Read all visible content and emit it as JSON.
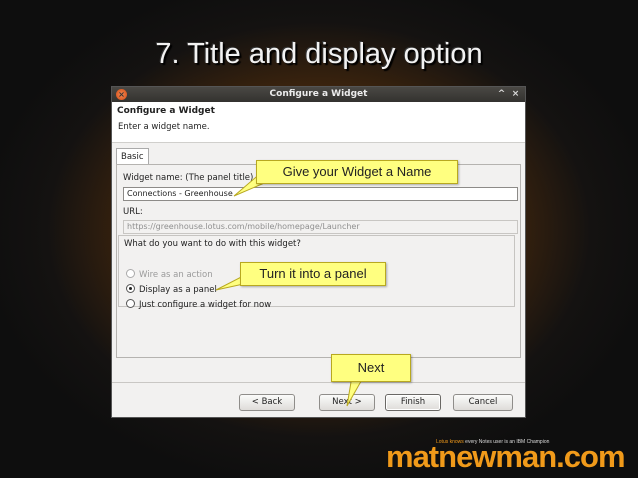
{
  "slide": {
    "title": "7. Title and display option"
  },
  "dialog": {
    "window_title": "Configure a Widget",
    "header_title": "Configure a Widget",
    "header_subtitle": "Enter a widget name.",
    "tab_label": "Basic",
    "widget_name_label": "Widget name: (The panel title)",
    "widget_name_value": "Connections - Greenhouse",
    "url_label": "URL:",
    "url_value": "https://greenhouse.lotus.com/mobile/homepage/Launcher",
    "group_label": "What do you want to do with this widget?",
    "options": [
      {
        "label": "Wire as an action",
        "checked": false,
        "disabled": true
      },
      {
        "label": "Display as a panel",
        "checked": true,
        "disabled": false
      },
      {
        "label": "Just configure a widget for now",
        "checked": false,
        "disabled": false
      }
    ],
    "buttons": {
      "back": "< Back",
      "next": "Next >",
      "finish": "Finish",
      "cancel": "Cancel"
    },
    "titlebar_icons": [
      "close-icon",
      "maximize-icon",
      "x-icon"
    ]
  },
  "callouts": {
    "name": "Give your Widget a Name",
    "panel": "Turn it into a panel",
    "next": "Next"
  },
  "branding": {
    "tagline_highlight": "Lotus knows",
    "tagline_rest": " every Notes user is an IBM Champion",
    "logo": "matnewman.com"
  },
  "colors": {
    "callout_fill": "#ffff80",
    "brand_orange": "#f09a1a"
  }
}
